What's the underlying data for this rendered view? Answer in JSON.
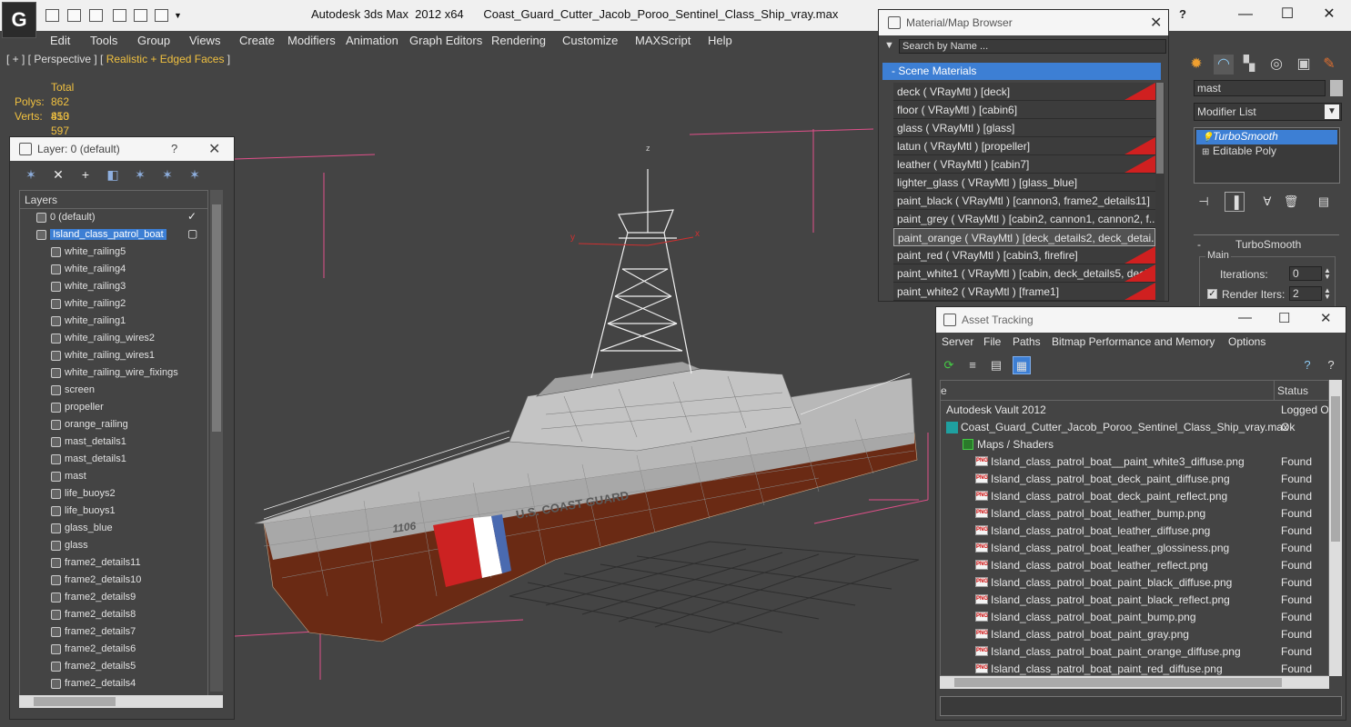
{
  "window": {
    "app_name": "Autodesk 3ds Max  2012 x64",
    "file_name": "Coast_Guard_Cutter_Jacob_Poroo_Sentinel_Class_Ship_vray.max",
    "help": "?",
    "minimize": "—",
    "maximize": "☐",
    "close": "✕"
  },
  "menubar": [
    "Edit",
    "Tools",
    "Group",
    "Views",
    "Create",
    "Modifiers",
    "Animation",
    "Graph Editors",
    "Rendering",
    "Customize",
    "MAXScript",
    "Help"
  ],
  "viewport": {
    "label_prefix": "[ + ] [ Perspective ] [ ",
    "label_mode": "Realistic + Edged Faces",
    "label_suffix": " ]",
    "stats": {
      "header": "Total",
      "polys_label": "Polys:",
      "polys": "862 810",
      "verts_label": "Verts:",
      "verts": "453 597"
    },
    "hull_number": "1106",
    "hull_text": "U.S. COAST GUARD",
    "gizmo_y": "y",
    "gizmo_x": "x",
    "gizmo_z": "z"
  },
  "layer_panel": {
    "title": "Layer: 0 (default)",
    "help": "?",
    "close": "✕",
    "header": "Layers",
    "layers": [
      {
        "name": "0 (default)",
        "indent": 1,
        "checked": true
      },
      {
        "name": "Island_class_patrol_boat",
        "indent": 1,
        "selected": true
      },
      {
        "name": "white_railing5",
        "indent": 2
      },
      {
        "name": "white_railing4",
        "indent": 2
      },
      {
        "name": "white_railing3",
        "indent": 2
      },
      {
        "name": "white_railing2",
        "indent": 2
      },
      {
        "name": "white_railing1",
        "indent": 2
      },
      {
        "name": "white_railing_wires2",
        "indent": 2
      },
      {
        "name": "white_railing_wires1",
        "indent": 2
      },
      {
        "name": "white_railing_wire_fixings",
        "indent": 2
      },
      {
        "name": "screen",
        "indent": 2
      },
      {
        "name": "propeller",
        "indent": 2
      },
      {
        "name": "orange_railing",
        "indent": 2
      },
      {
        "name": "mast_details1",
        "indent": 2
      },
      {
        "name": "mast_details1",
        "indent": 2
      },
      {
        "name": "mast",
        "indent": 2
      },
      {
        "name": "life_buoys2",
        "indent": 2
      },
      {
        "name": "life_buoys1",
        "indent": 2
      },
      {
        "name": "glass_blue",
        "indent": 2
      },
      {
        "name": "glass",
        "indent": 2
      },
      {
        "name": "frame2_details11",
        "indent": 2
      },
      {
        "name": "frame2_details10",
        "indent": 2
      },
      {
        "name": "frame2_details9",
        "indent": 2
      },
      {
        "name": "frame2_details8",
        "indent": 2
      },
      {
        "name": "frame2_details7",
        "indent": 2
      },
      {
        "name": "frame2_details6",
        "indent": 2
      },
      {
        "name": "frame2_details5",
        "indent": 2
      },
      {
        "name": "frame2_details4",
        "indent": 2
      }
    ]
  },
  "material_browser": {
    "title": "Material/Map Browser",
    "close": "✕",
    "search_placeholder": "Search by Name ...",
    "group": "- Scene Materials",
    "materials": [
      {
        "label": "deck  ( VRayMtl )  [deck]",
        "red": true
      },
      {
        "label": "floor  ( VRayMtl )  [cabin6]",
        "red": false
      },
      {
        "label": "glass  ( VRayMtl )  [glass]",
        "red": false
      },
      {
        "label": "latun  ( VRayMtl )  [propeller]",
        "red": true
      },
      {
        "label": "leather  ( VRayMtl )  [cabin7]",
        "red": true
      },
      {
        "label": "lighter_glass  ( VRayMtl )  [glass_blue]",
        "red": false
      },
      {
        "label": "paint_black  ( VRayMtl )  [cannon3, frame2_details11]",
        "red": false
      },
      {
        "label": "paint_grey  ( VRayMtl )  [cabin2, cannon1, cannon2, f...",
        "red": false
      },
      {
        "label": "paint_orange  ( VRayMtl )  [deck_details2, deck_detai...",
        "red": false,
        "hover": true
      },
      {
        "label": "paint_red  ( VRayMtl )  [cabin3, firefire]",
        "red": true
      },
      {
        "label": "paint_white1  ( VRayMtl )  [cabin, deck_details5, deck...",
        "red": true
      },
      {
        "label": "paint_white2  ( VRayMtl )  [frame1]",
        "red": true
      }
    ]
  },
  "command_panel": {
    "object_name": "mast",
    "modifier_list": "Modifier List",
    "stack": [
      {
        "label": "TurboSmooth",
        "selected": true
      },
      {
        "label": "Editable Poly",
        "selected": false
      }
    ],
    "rollout_title": "TurboSmooth",
    "rollout_toggle": "-",
    "main_label": "Main",
    "iterations_label": "Iterations:",
    "iterations": "0",
    "render_iters_label": "Render Iters:",
    "render_iters": "2",
    "render_iters_checked": true,
    "colors": {
      "selection": "#3d7fd4"
    }
  },
  "asset_tracking": {
    "title": "Asset Tracking",
    "minimize": "—",
    "maximize": "☐",
    "close": "✕",
    "menu": [
      "Server",
      "File",
      "Paths",
      "Bitmap Performance and Memory",
      "Options"
    ],
    "col_name": "e",
    "col_status": "Status",
    "rows": [
      {
        "name": "Autodesk Vault 2012",
        "status": "Logged O",
        "indent": 0,
        "icon": "none"
      },
      {
        "name": "Coast_Guard_Cutter_Jacob_Poroo_Sentinel_Class_Ship_vray.max",
        "status": "Ok",
        "indent": 1,
        "icon": "max"
      },
      {
        "name": "Maps / Shaders",
        "status": "",
        "indent": 2,
        "icon": "folder"
      },
      {
        "name": "Island_class_patrol_boat__paint_white3_diffuse.png",
        "status": "Found",
        "indent": 3,
        "icon": "png"
      },
      {
        "name": "Island_class_patrol_boat_deck_paint_diffuse.png",
        "status": "Found",
        "indent": 3,
        "icon": "png"
      },
      {
        "name": "Island_class_patrol_boat_deck_paint_reflect.png",
        "status": "Found",
        "indent": 3,
        "icon": "png"
      },
      {
        "name": "Island_class_patrol_boat_leather_bump.png",
        "status": "Found",
        "indent": 3,
        "icon": "png"
      },
      {
        "name": "Island_class_patrol_boat_leather_diffuse.png",
        "status": "Found",
        "indent": 3,
        "icon": "png"
      },
      {
        "name": "Island_class_patrol_boat_leather_glossiness.png",
        "status": "Found",
        "indent": 3,
        "icon": "png"
      },
      {
        "name": "Island_class_patrol_boat_leather_reflect.png",
        "status": "Found",
        "indent": 3,
        "icon": "png"
      },
      {
        "name": "Island_class_patrol_boat_paint_black_diffuse.png",
        "status": "Found",
        "indent": 3,
        "icon": "png"
      },
      {
        "name": "Island_class_patrol_boat_paint_black_reflect.png",
        "status": "Found",
        "indent": 3,
        "icon": "png"
      },
      {
        "name": "Island_class_patrol_boat_paint_bump.png",
        "status": "Found",
        "indent": 3,
        "icon": "png"
      },
      {
        "name": "Island_class_patrol_boat_paint_gray.png",
        "status": "Found",
        "indent": 3,
        "icon": "png"
      },
      {
        "name": "Island_class_patrol_boat_paint_orange_diffuse.png",
        "status": "Found",
        "indent": 3,
        "icon": "png"
      },
      {
        "name": "Island_class_patrol_boat_paint_red_diffuse.png",
        "status": "Found",
        "indent": 3,
        "icon": "png"
      }
    ]
  },
  "icons": {
    "png_badge": "PNG"
  }
}
